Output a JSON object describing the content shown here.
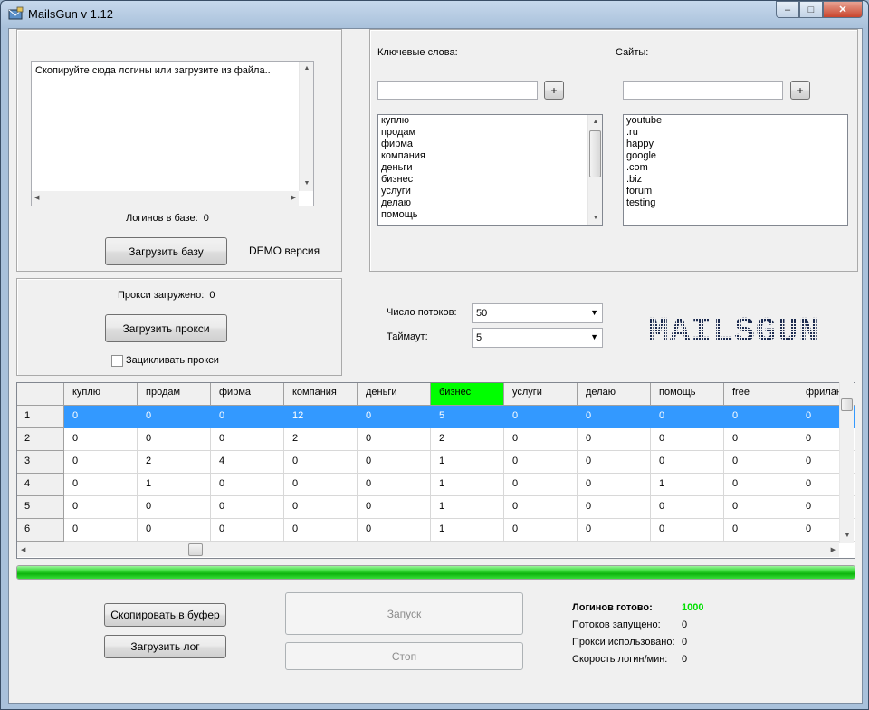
{
  "window": {
    "title": "MailsGun v 1.12"
  },
  "logins": {
    "textarea_text": "Скопируйте сюда логины или загрузите из файла..",
    "count_label": "Логинов в базе:",
    "count_value": "0",
    "load_button": "Загрузить базу",
    "demo_label": "DEMO версия"
  },
  "proxy": {
    "loaded_label": "Прокси загружено:",
    "loaded_value": "0",
    "load_button": "Загрузить прокси",
    "loop_label": "Зацикливать прокси"
  },
  "keywords": {
    "label": "Ключевые слова:",
    "add_button": "+",
    "items": [
      "куплю",
      "продам",
      "фирма",
      "компания",
      "деньги",
      "бизнес",
      "услуги",
      "делаю",
      "помощь"
    ]
  },
  "sites": {
    "label": "Сайты:",
    "add_button": "+",
    "items": [
      "youtube",
      ".ru",
      "happy",
      "google",
      ".com",
      ".biz",
      "forum",
      "testing"
    ]
  },
  "settings": {
    "threads_label": "Число потоков:",
    "threads_value": "50",
    "timeout_label": "Таймаут:",
    "timeout_value": "5"
  },
  "logo_text": "MAILSGUN",
  "grid": {
    "columns": [
      "куплю",
      "продам",
      "фирма",
      "компания",
      "деньги",
      "бизнес",
      "услуги",
      "делаю",
      "помощь",
      "free",
      "фрилан"
    ],
    "highlight_column": "бизнес",
    "rows": [
      {
        "id": "1",
        "values": [
          "0",
          "0",
          "0",
          "12",
          "0",
          "5",
          "0",
          "0",
          "0",
          "0",
          "0"
        ]
      },
      {
        "id": "2",
        "values": [
          "0",
          "0",
          "0",
          "2",
          "0",
          "2",
          "0",
          "0",
          "0",
          "0",
          "0"
        ]
      },
      {
        "id": "3",
        "values": [
          "0",
          "2",
          "4",
          "0",
          "0",
          "1",
          "0",
          "0",
          "0",
          "0",
          "0"
        ]
      },
      {
        "id": "4",
        "values": [
          "0",
          "1",
          "0",
          "0",
          "0",
          "1",
          "0",
          "0",
          "1",
          "0",
          "0"
        ]
      },
      {
        "id": "5",
        "values": [
          "0",
          "0",
          "0",
          "0",
          "0",
          "1",
          "0",
          "0",
          "0",
          "0",
          "0"
        ]
      },
      {
        "id": "6",
        "values": [
          "0",
          "0",
          "0",
          "0",
          "0",
          "1",
          "0",
          "0",
          "0",
          "0",
          "0"
        ]
      }
    ]
  },
  "progress": 1.0,
  "actions": {
    "copy_button": "Скопировать в буфер",
    "load_log_button": "Загрузить лог",
    "start_button": "Запуск",
    "stop_button": "Стоп"
  },
  "stats": {
    "ready_label": "Логинов готово:",
    "ready_value": "1000",
    "threads_label": "Потоков запущено:",
    "threads_value": "0",
    "proxies_label": "Прокси использовано:",
    "proxies_value": "0",
    "speed_label": "Скорость логин/мин:",
    "speed_value": "0"
  },
  "colors": {
    "highlight": "#00ff00",
    "selection": "#3399ff",
    "ready_value": "#00e000"
  }
}
